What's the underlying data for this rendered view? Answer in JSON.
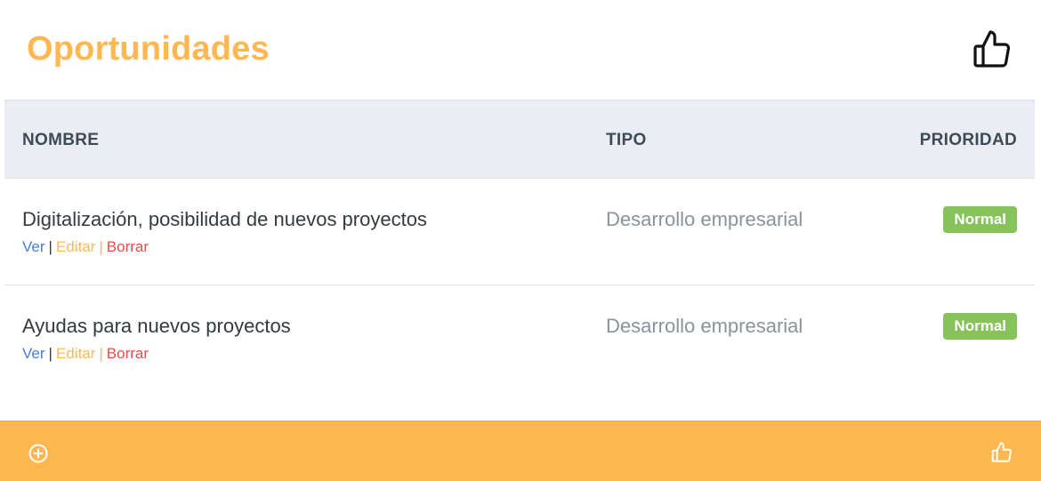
{
  "header": {
    "title": "Oportunidades",
    "icon": "thumbs-up-icon"
  },
  "table": {
    "columns": {
      "nombre": "NOMBRE",
      "tipo": "TIPO",
      "prioridad": "PRIORIDAD"
    },
    "rows": [
      {
        "nombre": "Digitalización, posibilidad de nuevos proyectos",
        "tipo": "Desarrollo empresarial",
        "prioridad": "Normal",
        "actions": {
          "ver": "Ver",
          "sep1": "|",
          "editar": "Editar",
          "sep2": "|",
          "borrar": "Borrar"
        }
      },
      {
        "nombre": "Ayudas para nuevos proyectos",
        "tipo": "Desarrollo empresarial",
        "prioridad": "Normal",
        "actions": {
          "ver": "Ver",
          "sep1": "|",
          "editar": "Editar",
          "sep2": "|",
          "borrar": "Borrar"
        }
      }
    ]
  },
  "footer": {
    "add_icon": "plus-circle-icon",
    "like_icon": "thumbs-up-icon"
  },
  "colors": {
    "accent": "#ffb752",
    "badge_normal": "#87c35a",
    "link_ver": "#4a7fe0",
    "link_borrar": "#ef4a4a"
  }
}
